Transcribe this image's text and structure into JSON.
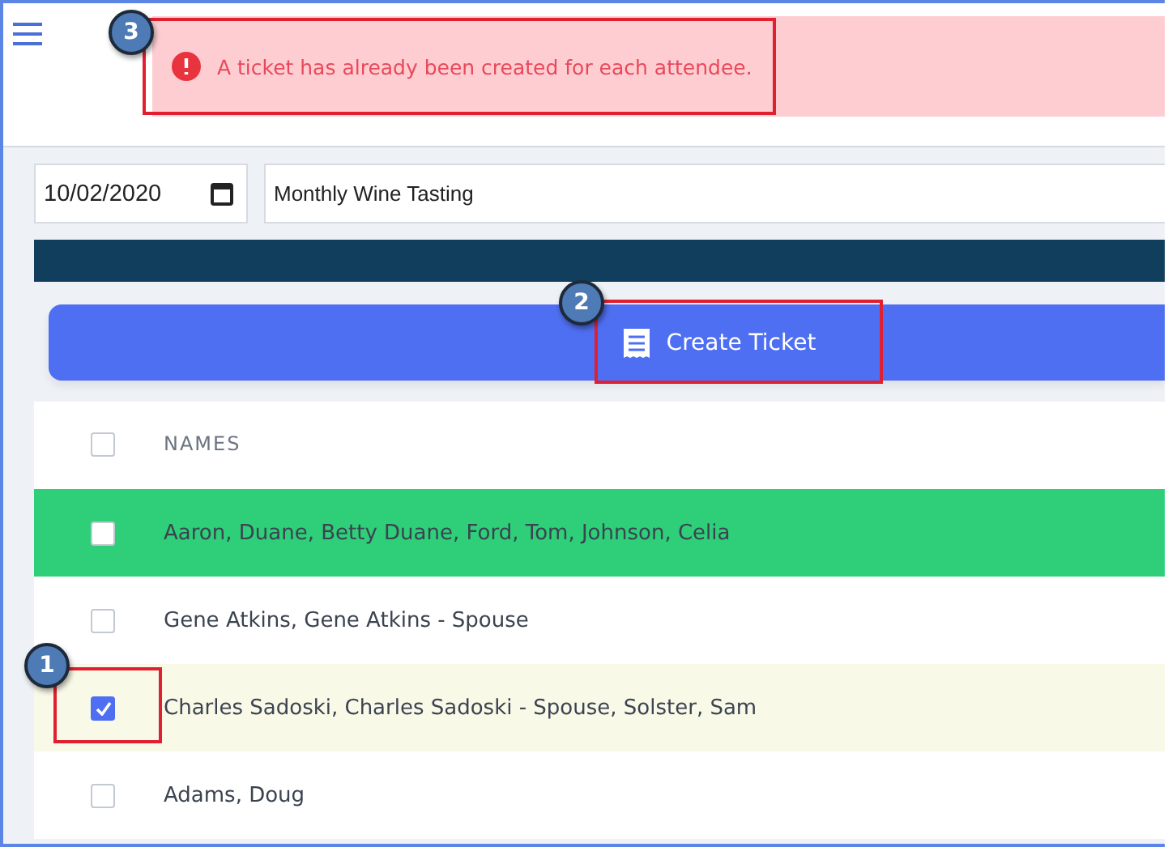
{
  "alert": {
    "message": "A ticket has already been created for each attendee."
  },
  "filters": {
    "date": "10/02/2020",
    "event": "Monthly Wine Tasting"
  },
  "create_button": {
    "label": "Create Ticket"
  },
  "table": {
    "header": {
      "label": "NAMES",
      "checked": false
    },
    "rows": [
      {
        "name": "Aaron, Duane, Betty Duane, Ford, Tom, Johnson, Celia",
        "checked": false,
        "color": "#2ecf78"
      },
      {
        "name": "Gene Atkins, Gene Atkins - Spouse",
        "checked": false,
        "color": "#ffffff"
      },
      {
        "name": "Charles Sadoski, Charles Sadoski - Spouse, Solster, Sam",
        "checked": true,
        "color": "#f9f9e8"
      },
      {
        "name": "Adams, Doug",
        "checked": false,
        "color": "#ffffff"
      }
    ]
  },
  "callouts": [
    {
      "number": "3"
    },
    {
      "number": "2"
    },
    {
      "number": "1"
    }
  ]
}
